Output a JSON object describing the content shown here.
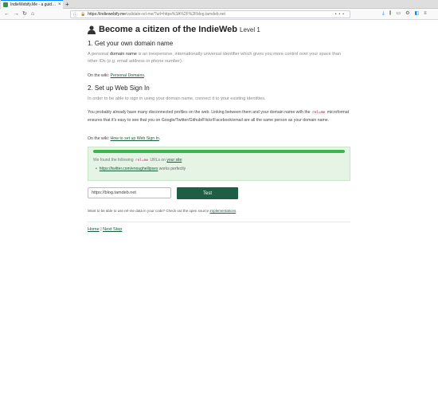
{
  "browser": {
    "tab_title": "IndieWebify.Me - a guid…",
    "tab_close": "×",
    "new_tab": "+",
    "url_host": "https://indiewebify.me",
    "url_path": "/validate-rel-me/?url=https%3A%2F%2Fblog.tamdeb.net",
    "url_actions": "•••",
    "nav": {
      "back": "←",
      "forward": "→",
      "reload": "↻",
      "home": "⌂"
    },
    "tool_icons": [
      "download-icon",
      "library-icon",
      "sidebar-icon",
      "extension-icon",
      "account-icon",
      "menu-icon"
    ]
  },
  "page": {
    "title": "Become a citizen of the IndieWeb",
    "level": "Level 1",
    "section1": {
      "heading": "1. Get your own domain name",
      "lead_pre": "A personal ",
      "lead_em": "domain name",
      "lead_post": " is an inexpensive, internationally universal identifier which gives you more control over your space than other IDs (e.g. email address or phone number).",
      "wiki_prefix": "On the wiki: ",
      "wiki_link": "Personal Domains",
      "wiki_suffix": "."
    },
    "section2": {
      "heading": "2. Set up Web Sign In",
      "lead": "In order to be able to sign in using your domain name, connect it to your existing identities.",
      "para_pre": "You probably already have many disconnected profiles on the web. Linking between them and your domain name with the ",
      "para_code": "rel=me",
      "para_post": " microformat ensures that it's easy to see that you on Google/Twitter/Github/Flickr/Facebook/email are all the same person as your domain name.",
      "wiki_prefix": "On the wiki: ",
      "wiki_link": "How to set up Web Sign In",
      "wiki_suffix": "."
    },
    "result": {
      "progress": 1.0,
      "found_pre": "We found the following ",
      "found_code": "rel=me",
      "found_mid": " URLs on ",
      "found_link": "your site",
      "found_post": ":",
      "item_link": "https://twitter.com/enoughellipses",
      "item_status": " works perfectly"
    },
    "form": {
      "input_value": "https://blog.tamdeb.net",
      "button_label": "Test"
    },
    "footnote_pre": "Want to be able to use rel-me data in your code? Check out the open source ",
    "footnote_link": "implementations",
    "footnote_post": ".",
    "footer": {
      "home": "Home",
      "separator": " | ",
      "next": "Next Step"
    }
  },
  "colors": {
    "accent": "#1e5e46",
    "progress": "#3fb34f",
    "result_bg": "#e5f4e4"
  }
}
